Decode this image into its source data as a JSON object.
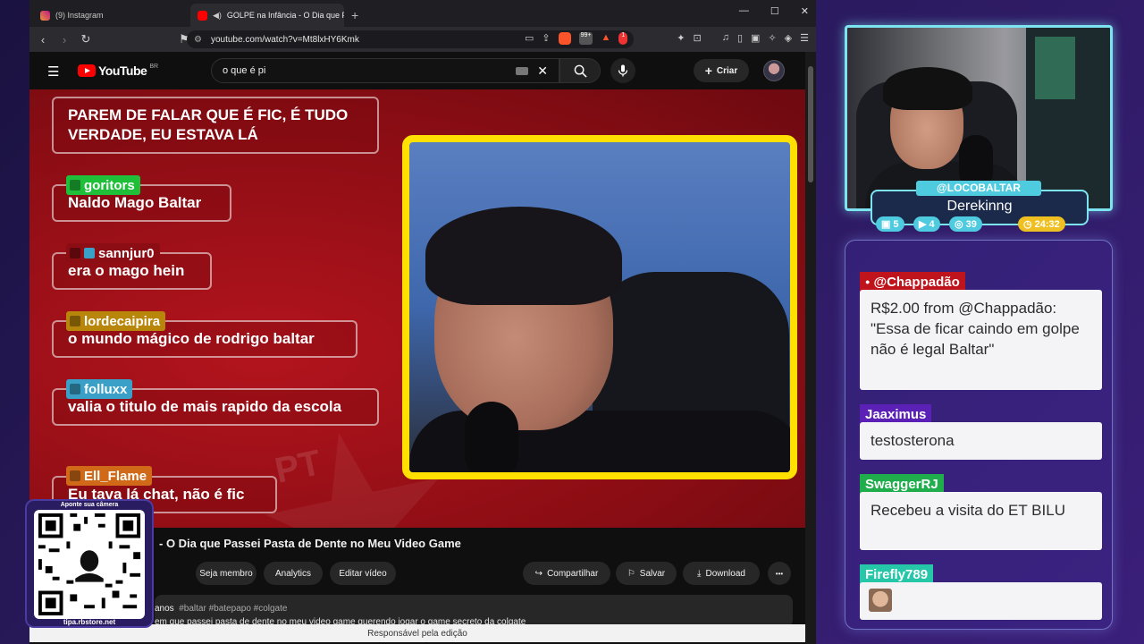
{
  "browser": {
    "tabs": [
      {
        "label": "(9) Instagram",
        "active": false
      },
      {
        "label": "GOLPE na Infância - O Dia que Pas...",
        "active": true
      }
    ],
    "url": "youtube.com/watch?v=Mt8lxHY6Kmk",
    "shield_badge": "99+",
    "alert_badge": "1"
  },
  "youtube": {
    "logo_text": "YouTube",
    "region": "BR",
    "search_value": "o que é pi",
    "create_label": "Criar",
    "video_title": "- O Dia que Passei Pasta de Dente no Meu Video Game",
    "buttons": {
      "member": "Seja membro",
      "analytics": "Analytics",
      "edit": "Editar vídeo",
      "share": "Compartilhar",
      "save": "Salvar",
      "download": "Download",
      "more": "•••"
    },
    "description": {
      "age": "anos",
      "tags": "#baltar #batepapo #colgate",
      "text": "em que passei pasta de dente no meu video game querendo jogar o game secreto da colgate"
    },
    "status_bar": "Responsável pela edição"
  },
  "video_chat": [
    {
      "name": "",
      "text": "PAREM DE FALAR QUE É FIC, É TUDO VERDADE, EU ESTAVA LÁ"
    },
    {
      "name": "goritors",
      "text": "Naldo Mago Baltar",
      "color": "#1fbf3a"
    },
    {
      "name": "sannjur0",
      "text": "era o mago hein",
      "color": "transparent"
    },
    {
      "name": "lordecaipira",
      "text": "o mundo mágico de rodrigo baltar",
      "color": "#b8860b"
    },
    {
      "name": "folluxx",
      "text": "valia o titulo de mais rapido da escola",
      "color": "#3aa0c8"
    },
    {
      "name": "Ell_Flame",
      "text": "Eu tava lá chat, não é fic",
      "color": "#d06a18"
    }
  ],
  "video_watermark": "PT",
  "qr": {
    "top_text": "Aponte sua câmera",
    "bottom_text": "tipa.rbstore.net"
  },
  "stream_overlay": {
    "handle": "@LOCOBALTAR",
    "name": "Derekinng",
    "stats": [
      {
        "icon": "twitch-icon",
        "value": "5",
        "color": "#4fcbe0"
      },
      {
        "icon": "youtube-icon",
        "value": "4",
        "color": "#4fcbe0"
      },
      {
        "icon": "kick-icon",
        "value": "39",
        "color": "#4fcbe0"
      },
      {
        "icon": "clock-icon",
        "value": "24:32",
        "color": "#f0c020"
      }
    ]
  },
  "side_chat": [
    {
      "name": "@Chappadão",
      "name_bg": "#c0141c",
      "text": "R$2.00 from @Chappadão: \"Essa de ficar caindo em golpe não é legal Baltar\""
    },
    {
      "name": "Jaaximus",
      "name_bg": "#5b21b6",
      "text": "testosterona"
    },
    {
      "name": "SwaggerRJ",
      "name_bg": "#1fae4b",
      "text": "Recebeu a visita do ET BILU"
    },
    {
      "name": "Firefly789",
      "name_bg": "#26c6a8",
      "text": ""
    }
  ]
}
